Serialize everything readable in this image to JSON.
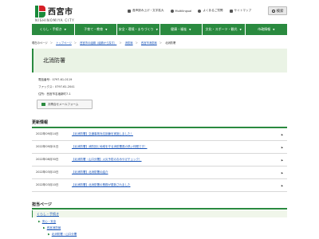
{
  "header": {
    "site_name": "西宮市",
    "site_sub": "NISHINOMIYA CITY",
    "links": [
      "音声読み上げ・文字拡大",
      "Multilingual",
      "よくあるご質問",
      "サイトマップ"
    ],
    "search_label": "検索"
  },
  "nav": [
    "くらし・手続き",
    "子育て・教育",
    "安全・環境・まちづくり",
    "健康・福祉",
    "文化・スポーツ・観光",
    "市政情報"
  ],
  "breadcrumb": {
    "here_label": "現在のページ",
    "items": [
      "トップページ",
      "西宮市の組織（組織から探す）",
      "消防局",
      "西宮市消防局",
      "北消防署"
    ]
  },
  "page": {
    "title": "北消防署",
    "tel": "電話番号：0797-61-0119",
    "fax": "ファックス：0797-61-2041",
    "address": "住所：西宮市名塩新町7-1",
    "mail_button": "お問合せメールフォーム"
  },
  "news": {
    "heading": "更新情報",
    "items": [
      {
        "date": "2022年09月14日",
        "title": "【北消防署】交通事故対応訓練を実施しました！"
      },
      {
        "date": "2022年09月01日",
        "title": "【北消防署】消防団と地域を守る消防署員の熱い仲間です！"
      },
      {
        "date": "2022年08月30日",
        "title": "【北消防署・山口分署】火災予防のおみやげチェック！"
      },
      {
        "date": "2022年03月10日",
        "title": "【北消防署】北消防署の紹介"
      },
      {
        "date": "2022年03月10日",
        "title": "【北消防署】北消防署の業務が更新されました"
      }
    ]
  },
  "section": {
    "heading": "担当ページ",
    "category": "くらし・手続き",
    "sub1": "安心・安全",
    "sub2": "西宮消防局",
    "sub3": "北消防署・山口分署"
  }
}
